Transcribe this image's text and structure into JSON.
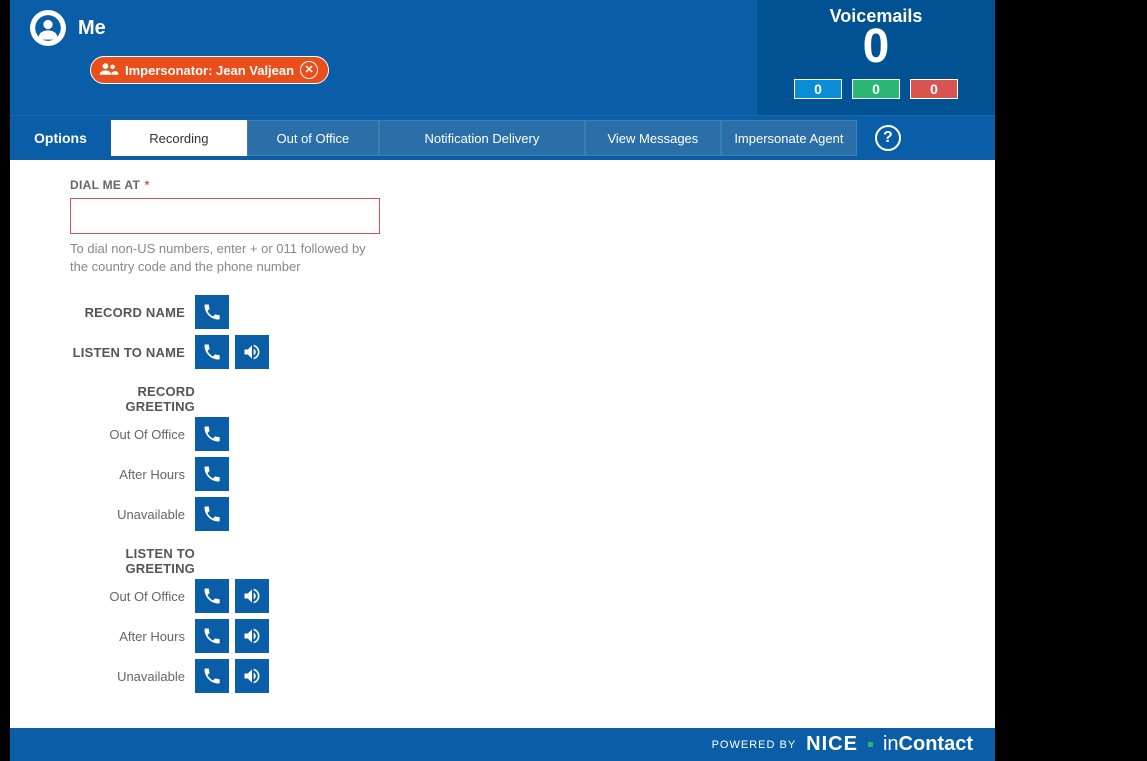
{
  "header": {
    "user_name": "Me",
    "impersonator_label": "Impersonator: Jean Valjean"
  },
  "voicemails": {
    "title": "Voicemails",
    "count": "0",
    "badges": {
      "blue": "0",
      "green": "0",
      "red": "0"
    }
  },
  "tabs": {
    "options_label": "Options",
    "items": [
      "Recording",
      "Out of Office",
      "Notification Delivery",
      "View Messages",
      "Impersonate Agent"
    ]
  },
  "form": {
    "dial_label": "DIAL ME AT",
    "dial_value": "",
    "dial_hint": "To dial non-US numbers, enter + or 011 followed by the country code and the phone number",
    "record_name": "RECORD NAME",
    "listen_to_name": "LISTEN TO NAME",
    "record_greeting": "RECORD GREETING",
    "listen_to_greeting": "LISTEN TO GREETING",
    "greetings": [
      "Out Of Office",
      "After Hours",
      "Unavailable"
    ]
  },
  "footer": {
    "powered_by": "POWERED BY",
    "brand1": "NICE",
    "brand2a": "in",
    "brand2b": "Contact"
  }
}
